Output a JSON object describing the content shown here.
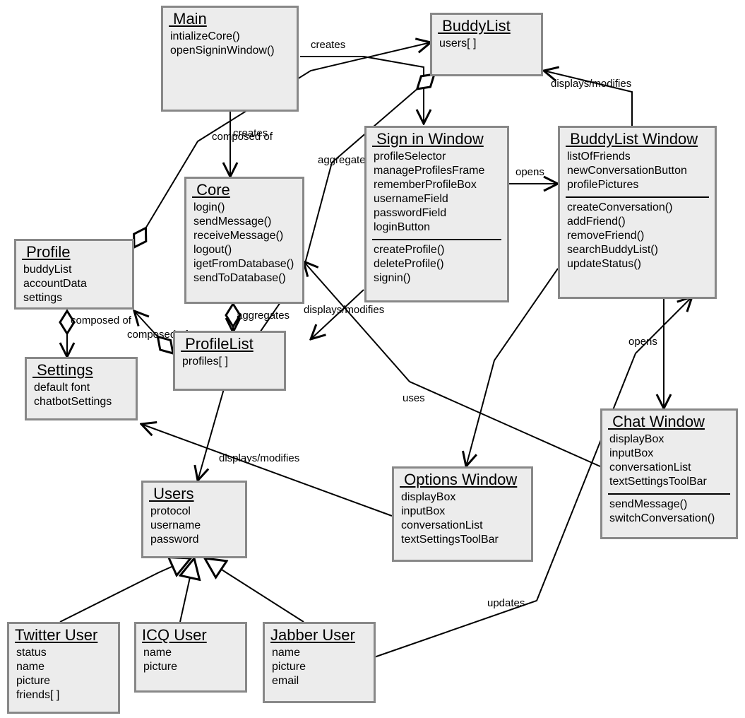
{
  "classes": {
    "main": {
      "title": " Main",
      "attrs": [
        "intializeCore()",
        "openSigninWindow()"
      ]
    },
    "buddylist": {
      "title": " BuddyList",
      "attrs": [
        "users[ ]"
      ]
    },
    "signin": {
      "title": " Sign in Window",
      "attrs": [
        "profileSelector",
        "manageProfilesFrame",
        "rememberProfileBox",
        "usernameField",
        "passwordField",
        "loginButton"
      ],
      "ops": [
        "createProfile()",
        "deleteProfile()",
        "signin()"
      ]
    },
    "buddylistwin": {
      "title": " BuddyList Window",
      "attrs": [
        "listOfFriends",
        "newConversationButton",
        "profilePictures"
      ],
      "ops": [
        "createConversation()",
        "addFriend()",
        "removeFriend()",
        "searchBuddyList()",
        "updateStatus()"
      ]
    },
    "core": {
      "title": " Core",
      "attrs": [
        "login()",
        "sendMessage()",
        "receiveMessage()",
        "logout()",
        "igetFromDatabase()",
        "sendToDatabase()"
      ]
    },
    "profile": {
      "title": " Profile",
      "attrs": [
        "buddyList",
        "accountData",
        "settings"
      ]
    },
    "profilelist": {
      "title": " ProfileList",
      "attrs": [
        "profiles[ ]"
      ]
    },
    "settings": {
      "title": " Settings",
      "attrs": [
        "default font",
        "chatbotSettings"
      ]
    },
    "chatwin": {
      "title": " Chat Window",
      "attrs": [
        "displayBox",
        "inputBox",
        "conversationList",
        "textSettingsToolBar"
      ],
      "ops": [
        "sendMessage()",
        "switchConversation()"
      ]
    },
    "optionswin": {
      "title": " Options Window",
      "attrs": [
        "displayBox",
        "inputBox",
        "conversationList",
        "textSettingsToolBar"
      ]
    },
    "users": {
      "title": " Users",
      "attrs": [
        "protocol",
        "username",
        "password"
      ]
    },
    "twitter": {
      "title": "Twitter User",
      "attrs": [
        "status",
        "name",
        "picture",
        "friends[ ]"
      ]
    },
    "icq": {
      "title": "ICQ User",
      "attrs": [
        "name",
        "picture"
      ]
    },
    "jabber": {
      "title": "Jabber User",
      "attrs": [
        "name",
        "picture",
        "email"
      ]
    }
  },
  "labels": {
    "creates1": "creates",
    "creates2": "creates",
    "composed1": "composed of",
    "composed2": "composed of",
    "composed3": "composed of",
    "aggregates1": "aggregates",
    "aggregates2": "aggregates",
    "displays1": "displays/modifies",
    "displays2": "displays/modifies",
    "displays3": "displays/modifies",
    "opens1": "opens",
    "opens2": "opens",
    "uses": "uses",
    "updates": "updates"
  }
}
